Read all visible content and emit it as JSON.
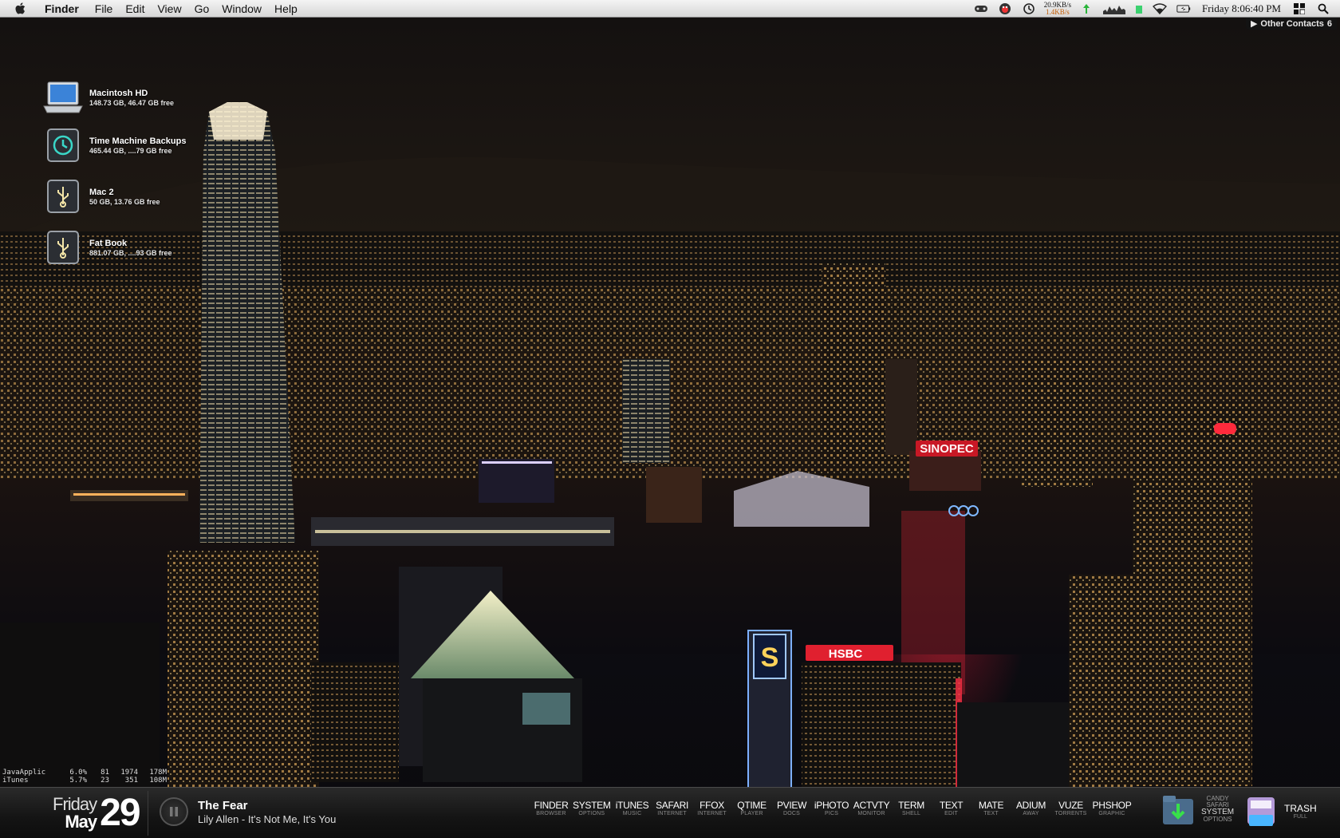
{
  "menubar": {
    "app_name": "Finder",
    "menus": [
      "File",
      "Edit",
      "View",
      "Go",
      "Window",
      "Help"
    ],
    "network": {
      "up": "20.9KB/s",
      "down": "1.4KB/s"
    },
    "clock": "Friday 8:06:40 PM",
    "status_icons": [
      "gamepad-icon",
      "adium-duck-icon",
      "time-machine-icon",
      "upload-arrow-icon",
      "activity-graph-icon",
      "wifi-icon",
      "battery-icon",
      "spaces-icon",
      "spotlight-icon"
    ]
  },
  "contacts_badge": {
    "label": "Other Contacts",
    "count": "6"
  },
  "desktop_icons": [
    {
      "name": "Macintosh HD",
      "info": "148.73 GB, 46.47 GB free",
      "icon": "laptop-drive-icon"
    },
    {
      "name": "Time Machine Backups",
      "info": "465.44 GB, ....79 GB free",
      "icon": "time-machine-drive-icon"
    },
    {
      "name": "Mac 2",
      "info": "50 GB, 13.76 GB free",
      "icon": "usb-drive-icon"
    },
    {
      "name": "Fat Book",
      "info": "881.07 GB, ....93 GB free",
      "icon": "usb-drive-icon"
    }
  ],
  "process_monitor": [
    [
      "JavaApplic",
      "6.0%",
      "81",
      "1974",
      "178M"
    ],
    [
      "iTunes",
      "5.7%",
      "23",
      "351",
      "108M"
    ]
  ],
  "dock": {
    "date": {
      "weekday": "Friday",
      "month": "May",
      "day": "29"
    },
    "now_playing": {
      "title": "The Fear",
      "artist": "Lily Allen - It's Not Me, It's You"
    },
    "launchers": [
      {
        "name": "FINDER",
        "sub": "BROWSER"
      },
      {
        "name": "SYSTEM",
        "sub": "OPTIONS"
      },
      {
        "name": "iTUNES",
        "sub": "MUSIC"
      },
      {
        "name": "SAFARI",
        "sub": "INTERNET"
      },
      {
        "name": "FFOX",
        "sub": "INTERNET"
      },
      {
        "name": "QTIME",
        "sub": "PLAYER"
      },
      {
        "name": "PVIEW",
        "sub": "DOCS"
      },
      {
        "name": "iPHOTO",
        "sub": "PICS"
      },
      {
        "name": "ACTVTY",
        "sub": "MONITOR"
      },
      {
        "name": "TERM",
        "sub": "SHELL"
      },
      {
        "name": "TEXT",
        "sub": "EDIT"
      },
      {
        "name": "MATE",
        "sub": "TEXT"
      },
      {
        "name": "ADIUM",
        "sub": "AWAY"
      },
      {
        "name": "VUZE",
        "sub": "TORRENTS"
      },
      {
        "name": "PHSHOP",
        "sub": "GRAPHIC"
      }
    ],
    "downloads_stack": {
      "label_lines": [
        "CANDY",
        "SAFARI",
        "SYSTEM",
        "OPTIONS"
      ]
    },
    "trash": {
      "name": "TRASH",
      "sub": "FULL"
    }
  },
  "wallpaper_signs": [
    "SINOPEC",
    "HSBC"
  ],
  "colors": {
    "menubar": "#e4e4e4",
    "dock": "#161616",
    "sign_red": "#ff2a3c"
  }
}
